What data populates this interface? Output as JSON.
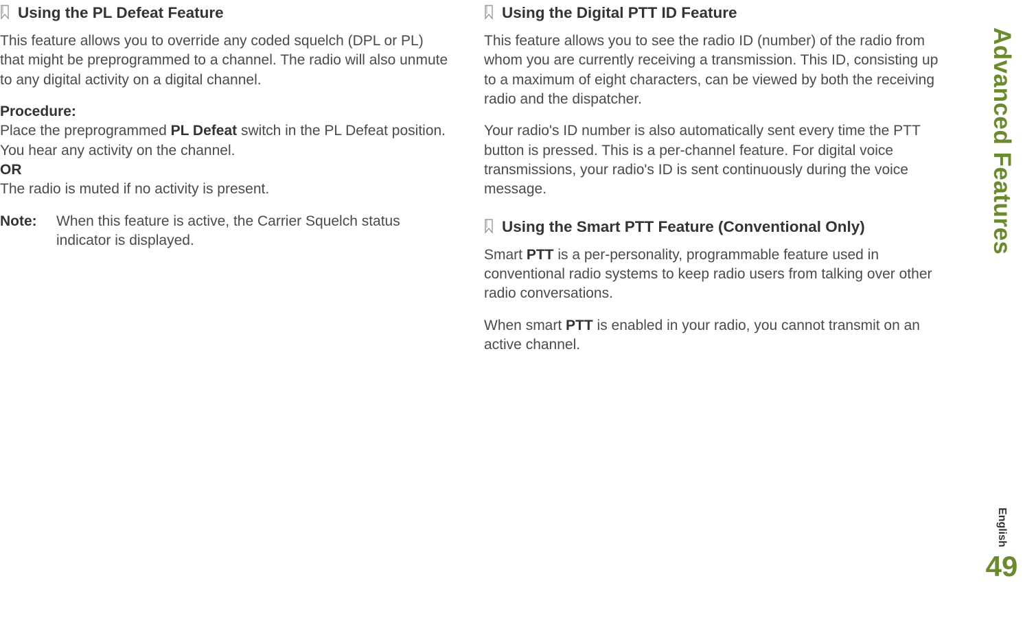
{
  "sidebar": {
    "title": "Advanced Features",
    "language": "English",
    "page_number": "49"
  },
  "left_column": {
    "section1": {
      "heading": "Using the PL Defeat Feature",
      "para1": "This feature allows you to override any coded squelch (DPL or PL) that might be preprogrammed to a channel. The radio will also unmute to any digital activity on a digital channel.",
      "procedure_label": "Procedure:",
      "proc_line1_a": "Place the preprogrammed ",
      "proc_line1_bold": "PL Defeat",
      "proc_line1_b": " switch in the PL Defeat position. You hear any activity on the channel.",
      "or_label": "OR",
      "proc_line2": "The radio is muted if no activity is present.",
      "note_label": "Note:",
      "note_text": "When this feature is active, the Carrier Squelch status indicator is displayed."
    }
  },
  "right_column": {
    "section1": {
      "heading": "Using the Digital PTT ID Feature",
      "para1": "This feature allows you to see the radio ID (number) of the radio from whom you are currently receiving a transmission. This ID, consisting up to a maximum of eight characters, can be viewed by both the receiving radio and the dispatcher.",
      "para2": "Your radio's ID number is also automatically sent every time the PTT button is pressed. This is a per-channel feature. For digital voice transmissions, your radio's ID is sent continuously during the voice message."
    },
    "section2": {
      "heading": "Using the Smart PTT Feature (Conventional Only)",
      "para1_a": "Smart ",
      "para1_bold": "PTT",
      "para1_b": " is a per-personality, programmable feature used in conventional radio systems to keep radio users from talking over other radio conversations.",
      "para2_a": "When smart ",
      "para2_bold": "PTT",
      "para2_b": " is enabled in your radio, you cannot transmit on an active channel."
    }
  }
}
